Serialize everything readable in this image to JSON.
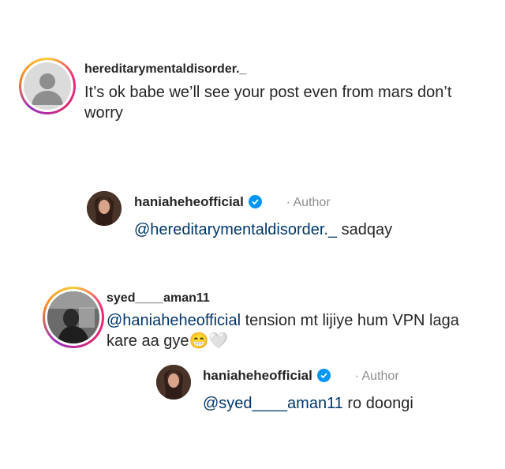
{
  "comments": [
    {
      "username": "hereditarymentaldisorder._",
      "text": "It’s ok babe we’ll see your post even from mars don’t worry"
    },
    {
      "username": "haniaheheofficial",
      "author_label": "· Author",
      "mention": "@hereditarymentaldisorder._",
      "text": " sadqay"
    },
    {
      "username": "syed____aman11",
      "mention": "@haniaheheofficial",
      "text": " tension mt lijiye hum VPN laga kare aa gye",
      "emoji": "😁",
      "emoji2": "🤍"
    },
    {
      "username": "haniaheheofficial",
      "author_label": "· Author",
      "mention": "@syed____aman11",
      "text": " ro doongi"
    }
  ],
  "colors": {
    "mention": "#00376b",
    "verified": "#0095f6",
    "muted": "#8e8e8e"
  }
}
